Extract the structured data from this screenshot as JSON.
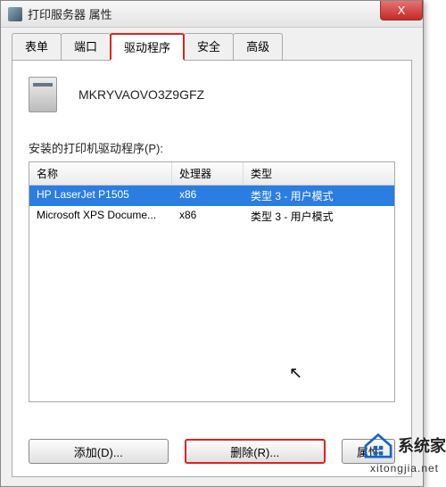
{
  "window": {
    "title": "打印服务器 属性"
  },
  "close": "X",
  "tabs": {
    "items": [
      {
        "label": "表单"
      },
      {
        "label": "端口"
      },
      {
        "label": "驱动程序"
      },
      {
        "label": "安全"
      },
      {
        "label": "高级"
      }
    ]
  },
  "server": {
    "name": "MKRYVAOVO3Z9GFZ"
  },
  "list_label": "安装的打印机驱动程序(P):",
  "columns": {
    "name": "名称",
    "proc": "处理器",
    "type": "类型"
  },
  "rows": [
    {
      "name": "HP LaserJet P1505",
      "proc": "x86",
      "type": "类型 3 - 用户模式"
    },
    {
      "name": "Microsoft XPS Docume...",
      "proc": "x86",
      "type": "类型 3 - 用户模式"
    }
  ],
  "buttons": {
    "add": "添加(D)...",
    "remove": "删除(R)...",
    "prop": "属性"
  },
  "watermark": {
    "brand": "系统家",
    "url": "xitongjia.net"
  }
}
